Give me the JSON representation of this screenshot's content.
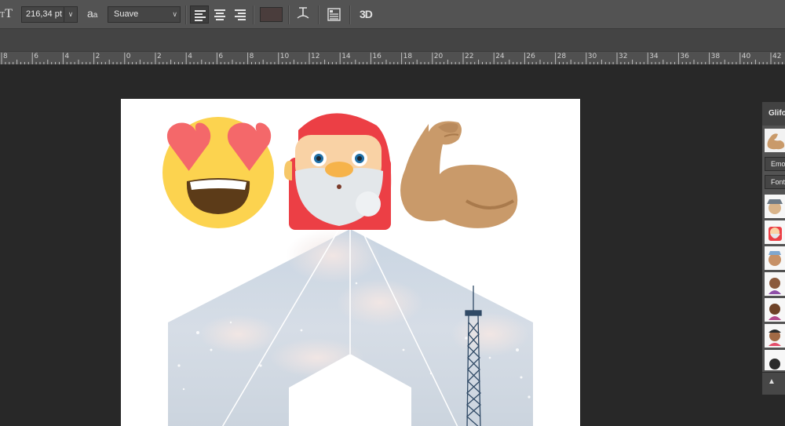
{
  "options_bar": {
    "font_size_icon": "font-size-icon",
    "font_size": "216,34 pt",
    "aa_label": "a",
    "aa_label_small": "a",
    "anti_alias": "Suave",
    "dropdown_arrow": "∨",
    "text_color": "#4a3d3c",
    "three_d": "3D"
  },
  "ruler": {
    "labels": [
      "8",
      "6",
      "4",
      "2",
      "0",
      "2",
      "4",
      "6",
      "8",
      "10",
      "12",
      "14",
      "16",
      "18",
      "20",
      "22",
      "24",
      "26",
      "28",
      "30",
      "32",
      "34",
      "36",
      "38",
      "40",
      "42"
    ]
  },
  "glyphs_panel": {
    "title": "Glifos",
    "font_family": "Emoji",
    "font_style": "Fonte",
    "collapse": "▲"
  }
}
